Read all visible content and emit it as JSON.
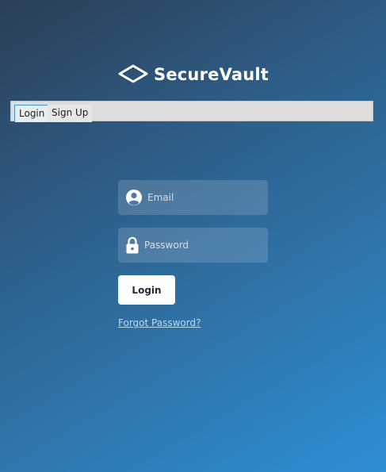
{
  "brand": {
    "name": "SecureVault",
    "logo_icon": "diamond-outline-icon"
  },
  "tabs": [
    {
      "label": "Login",
      "selected": true
    },
    {
      "label": "Sign Up",
      "selected": false
    }
  ],
  "form": {
    "email": {
      "icon": "user-circle-icon",
      "value": "",
      "placeholder": "Email"
    },
    "password": {
      "icon": "lock-icon",
      "value": "",
      "placeholder": "Password"
    },
    "submit_label": "Login",
    "forgot_label": "Forgot Password?"
  },
  "colors": {
    "background_start": "#2b3f58",
    "background_end": "#2f8fd4",
    "tab_selected_border": "#3d96cf",
    "link": "#b9dcf3"
  }
}
